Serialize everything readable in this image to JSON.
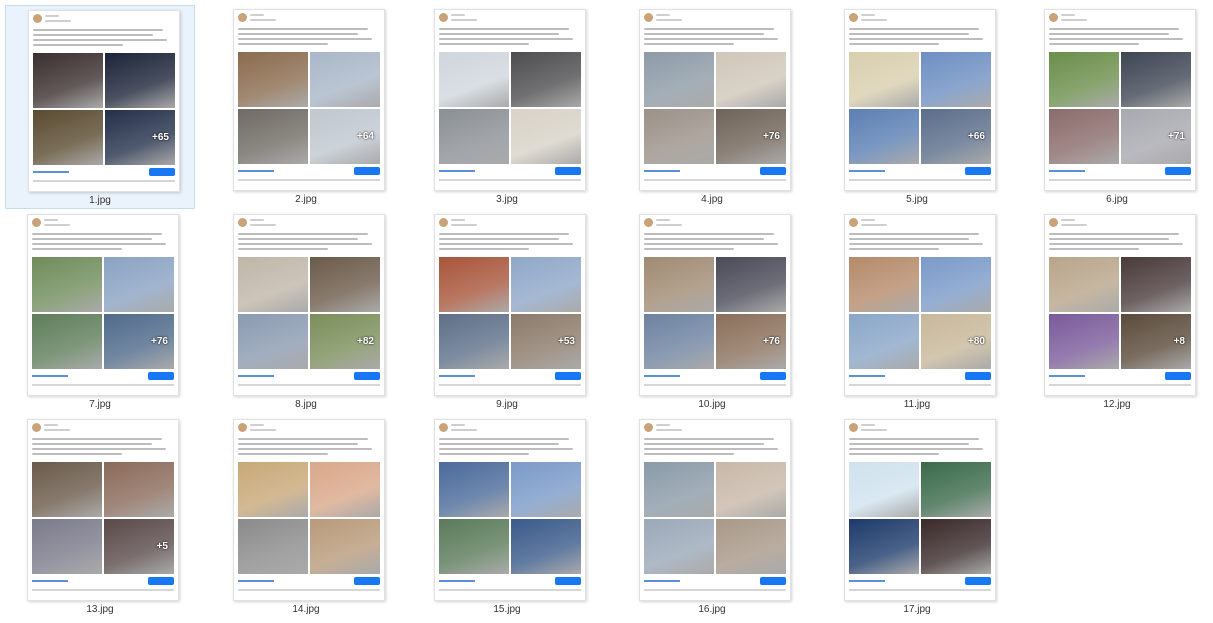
{
  "files": [
    {
      "name": "1.jpg",
      "more": "+65",
      "selected": true,
      "colors": [
        "#3b2f2f",
        "#1c2438",
        "#5a4a30",
        "#24304a"
      ]
    },
    {
      "name": "2.jpg",
      "more": "+64",
      "selected": false,
      "colors": [
        "#8a6b4e",
        "#a9b7c8",
        "#6f6a63",
        "#bfc7cf"
      ]
    },
    {
      "name": "3.jpg",
      "more": "",
      "selected": false,
      "colors": [
        "#cfd6dc",
        "#4d4d4f",
        "#8a8f94",
        "#d8d2c7"
      ]
    },
    {
      "name": "4.jpg",
      "more": "+76",
      "selected": false,
      "colors": [
        "#8d9aa6",
        "#cfc7b9",
        "#9a9188",
        "#6f6358"
      ]
    },
    {
      "name": "5.jpg",
      "more": "+66",
      "selected": false,
      "colors": [
        "#d9cfae",
        "#6d8fc2",
        "#5b7fb3",
        "#5a6d8a"
      ]
    },
    {
      "name": "6.jpg",
      "more": "+71",
      "selected": false,
      "colors": [
        "#6a8e4a",
        "#3e4654",
        "#8a6b6b",
        "#a8a8b0"
      ]
    },
    {
      "name": "7.jpg",
      "more": "+76",
      "selected": false,
      "colors": [
        "#6f8c5a",
        "#8aa2c2",
        "#5e7d5a",
        "#4f6a8a"
      ]
    },
    {
      "name": "8.jpg",
      "more": "+82",
      "selected": false,
      "colors": [
        "#bfb6a8",
        "#6b5a4a",
        "#8a9ab0",
        "#7a8e5a"
      ]
    },
    {
      "name": "9.jpg",
      "more": "+53",
      "selected": false,
      "colors": [
        "#a8553a",
        "#8fa7c8",
        "#5d6f88",
        "#8b7a6a"
      ]
    },
    {
      "name": "10.jpg",
      "more": "+76",
      "selected": false,
      "colors": [
        "#a08a72",
        "#4a4a58",
        "#6d82a0",
        "#8a6f5a"
      ]
    },
    {
      "name": "11.jpg",
      "more": "+80",
      "selected": false,
      "colors": [
        "#b58a6a",
        "#7a9ac8",
        "#8aa6c8",
        "#c8b89a"
      ]
    },
    {
      "name": "12.jpg",
      "more": "+8",
      "selected": false,
      "colors": [
        "#b8a58a",
        "#4a3a3a",
        "#7a5a9a",
        "#5a4a3a"
      ]
    },
    {
      "name": "13.jpg",
      "more": "+5",
      "selected": false,
      "colors": [
        "#6a5a4a",
        "#8a6a5a",
        "#7a7a8a",
        "#5a4a4a"
      ]
    },
    {
      "name": "14.jpg",
      "more": "",
      "selected": false,
      "colors": [
        "#c8a878",
        "#d9a88a",
        "#8a8a8a",
        "#b89a7a"
      ]
    },
    {
      "name": "15.jpg",
      "more": "",
      "selected": false,
      "colors": [
        "#4a6a9a",
        "#7a9ac8",
        "#5a7a5a",
        "#3a5a8a"
      ]
    },
    {
      "name": "16.jpg",
      "more": "",
      "selected": false,
      "colors": [
        "#8a9aa8",
        "#c8b8a8",
        "#9aa8b8",
        "#a89888"
      ]
    },
    {
      "name": "17.jpg",
      "more": "",
      "selected": false,
      "colors": [
        "#d0e2ee",
        "#3a6a4a",
        "#1c3a6a",
        "#3a2a2a"
      ]
    }
  ]
}
